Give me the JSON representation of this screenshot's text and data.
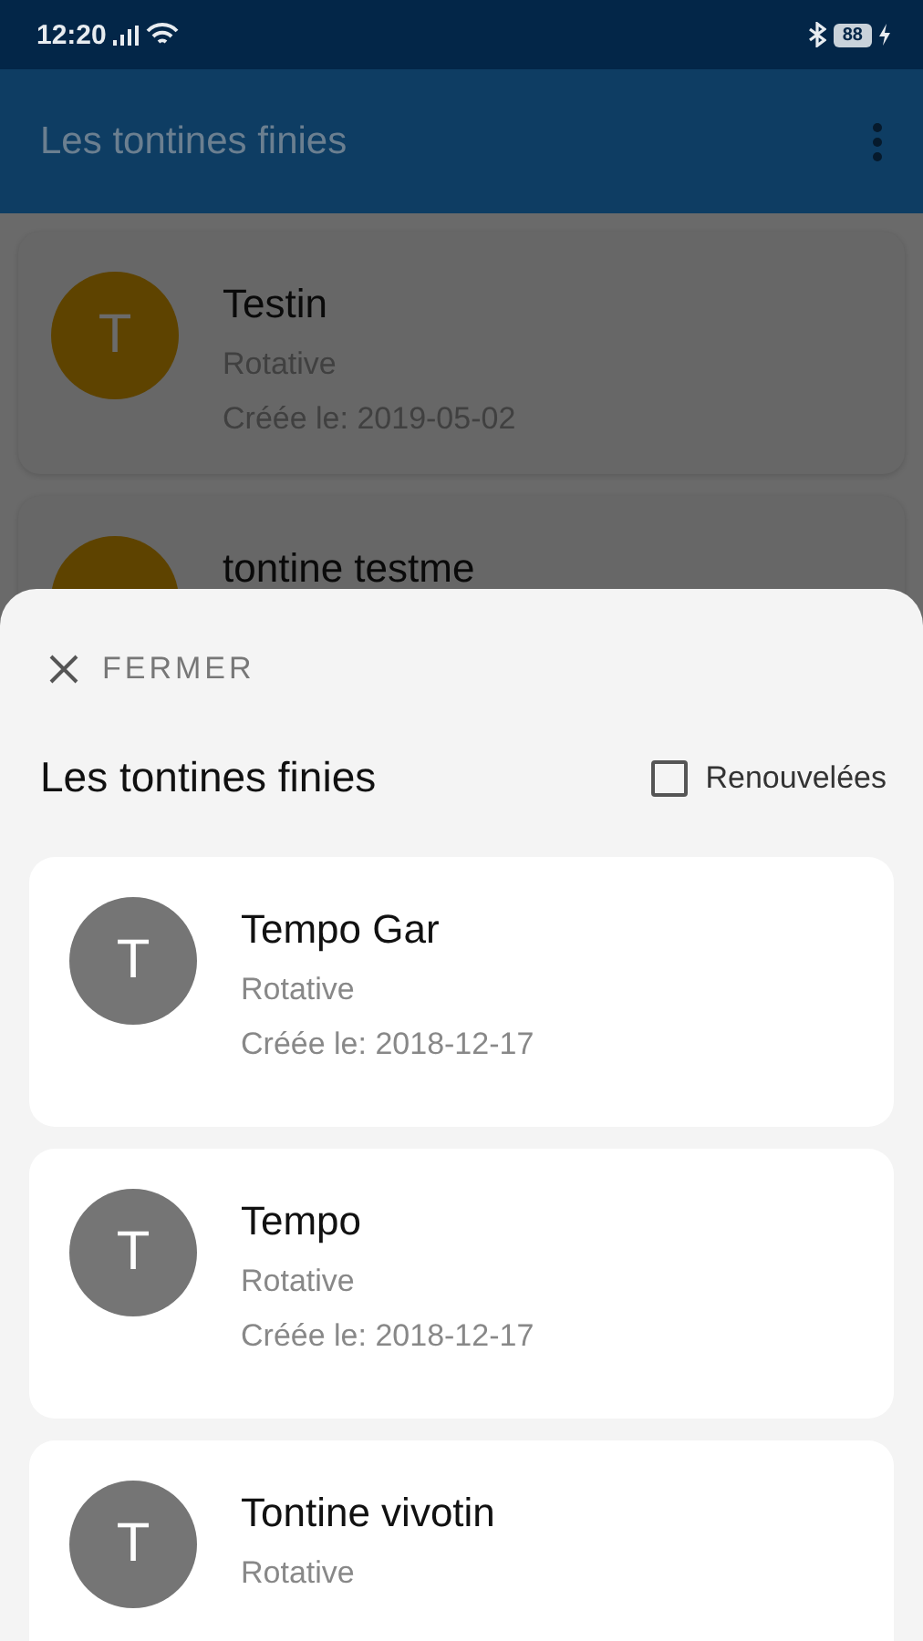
{
  "status_bar": {
    "time": "12:20",
    "battery": "88"
  },
  "app_bar": {
    "title": "Les tontines finies"
  },
  "background_list": [
    {
      "initial": "T",
      "name": "Testin",
      "type": "Rotative",
      "created": "Créée le: 2019-05-02"
    },
    {
      "name": "tontine testme"
    }
  ],
  "sheet": {
    "close_label": "FERMER",
    "title": "Les tontines finies",
    "filter": {
      "label": "Renouvelées",
      "checked": false
    },
    "items": [
      {
        "initial": "T",
        "name": "Tempo Gar",
        "type": "Rotative",
        "created": "Créée le: 2018-12-17"
      },
      {
        "initial": "T",
        "name": "Tempo",
        "type": "Rotative",
        "created": "Créée le: 2018-12-17"
      },
      {
        "initial": "T",
        "name": "Tontine vivotin",
        "type": "Rotative"
      }
    ]
  }
}
